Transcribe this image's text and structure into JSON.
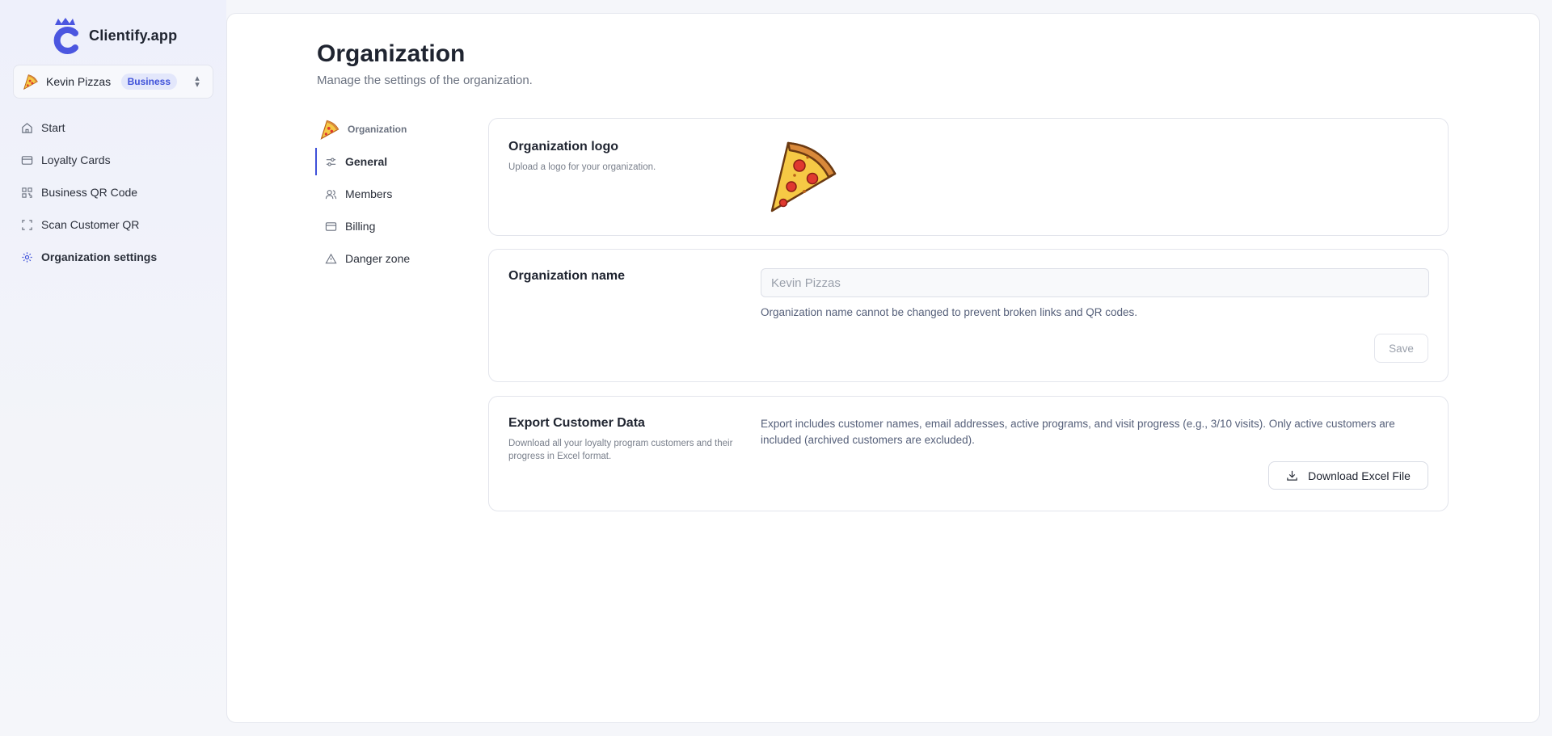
{
  "brand": {
    "name": "Clientify.app"
  },
  "org_switcher": {
    "name": "Kevin Pizzas",
    "plan_badge": "Business"
  },
  "sidebar": {
    "items": [
      {
        "label": "Start",
        "icon": "home-icon"
      },
      {
        "label": "Loyalty Cards",
        "icon": "card-icon"
      },
      {
        "label": "Business QR Code",
        "icon": "qr-icon"
      },
      {
        "label": "Scan Customer QR",
        "icon": "scan-icon"
      },
      {
        "label": "Organization settings",
        "icon": "gear-icon",
        "active": true
      }
    ]
  },
  "page": {
    "title": "Organization",
    "subtitle": "Manage the settings of the organization."
  },
  "subnav": {
    "header": "Organization",
    "items": [
      {
        "label": "General",
        "icon": "sliders-icon",
        "active": true
      },
      {
        "label": "Members",
        "icon": "users-icon"
      },
      {
        "label": "Billing",
        "icon": "credit-card-icon"
      },
      {
        "label": "Danger zone",
        "icon": "warning-icon"
      }
    ]
  },
  "logo_card": {
    "title": "Organization logo",
    "description": "Upload a logo for your organization."
  },
  "name_card": {
    "title": "Organization name",
    "input_value": "Kevin Pizzas",
    "hint": "Organization name cannot be changed to prevent broken links and QR codes.",
    "save_label": "Save"
  },
  "export_card": {
    "title": "Export Customer Data",
    "description": "Download all your loyalty program customers and their progress in Excel format.",
    "text": "Export includes customer names, email addresses, active programs, and visit progress (e.g., 3/10 visits). Only active customers are included (archived customers are excluded).",
    "button_label": "Download Excel File"
  },
  "colors": {
    "accent": "#3f51d9",
    "badge_bg": "#e3e7fb"
  }
}
